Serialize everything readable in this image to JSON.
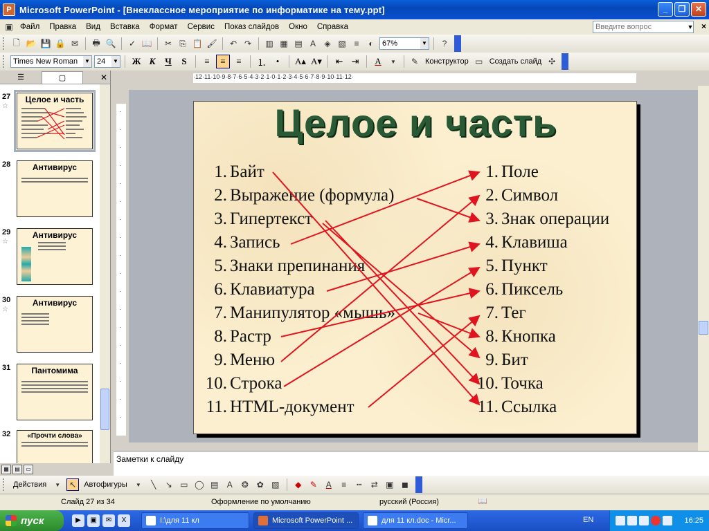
{
  "window": {
    "title": "Microsoft PowerPoint - [Внеклассное мероприятие по информатике на тему.ppt]",
    "app_icon_letter": "P"
  },
  "menu": {
    "items": [
      "Файл",
      "Правка",
      "Вид",
      "Вставка",
      "Формат",
      "Сервис",
      "Показ слайдов",
      "Окно",
      "Справка"
    ],
    "ask_placeholder": "Введите вопрос"
  },
  "toolbar": {
    "zoom": "67%"
  },
  "format_toolbar": {
    "font": "Times New Roman",
    "size": "24",
    "bold": "Ж",
    "italic": "К",
    "underline": "Ч",
    "shadow": "S",
    "designer": "Конструктор",
    "new_slide": "Создать слайд"
  },
  "slides_panel": {
    "thumbs": [
      {
        "num": "27",
        "title": "Целое и часть"
      },
      {
        "num": "28",
        "title": "Антивирус"
      },
      {
        "num": "29",
        "title": "Антивирус"
      },
      {
        "num": "30",
        "title": "Антивирус"
      },
      {
        "num": "31",
        "title": "Пантомима"
      },
      {
        "num": "32",
        "title": "«Прочти слова»"
      }
    ]
  },
  "ruler": {
    "horizontal": "·12·11·10·9·8·7·6·5·4·3·2·1·0·1·2·3·4·5·6·7·8·9·10·11·12·"
  },
  "slide": {
    "title": "Целое и часть",
    "left": [
      {
        "n": "1.",
        "t": "Байт"
      },
      {
        "n": "2.",
        "t": "Выражение (формула)"
      },
      {
        "n": "3.",
        "t": "Гипертекст"
      },
      {
        "n": "4.",
        "t": "Запись"
      },
      {
        "n": "5.",
        "t": "Знаки препинания"
      },
      {
        "n": "6.",
        "t": "Клавиатура"
      },
      {
        "n": "7.",
        "t": "Манипулятор «мышь»"
      },
      {
        "n": "8.",
        "t": "Растр"
      },
      {
        "n": "9.",
        "t": "Меню"
      },
      {
        "n": "10.",
        "t": "Строка"
      },
      {
        "n": "11.",
        "t": "HTML-документ"
      }
    ],
    "right": [
      {
        "n": "1.",
        "t": "Поле"
      },
      {
        "n": "2.",
        "t": "Символ"
      },
      {
        "n": "3.",
        "t": "Знак операции"
      },
      {
        "n": "4.",
        "t": "Клавиша"
      },
      {
        "n": "5.",
        "t": "Пункт"
      },
      {
        "n": "6.",
        "t": "Пиксель"
      },
      {
        "n": "7.",
        "t": "Тег"
      },
      {
        "n": "8.",
        "t": "Кнопка"
      },
      {
        "n": "9.",
        "t": "Бит"
      },
      {
        "n": "10.",
        "t": "Точка"
      },
      {
        "n": "11.",
        "t": "Ссылка"
      }
    ],
    "arrow_color": "#e0141e",
    "title_color": "#2a5a35"
  },
  "notes": {
    "placeholder": "Заметки к слайду"
  },
  "drawing": {
    "actions": "Действия",
    "autoshapes": "Автофигуры"
  },
  "status": {
    "slide": "Слайд 27 из 34",
    "design": "Оформление по умолчанию",
    "language": "русский (Россия)"
  },
  "taskbar": {
    "start": "пуск",
    "tasks": [
      "I:\\для 11 кл",
      "Microsoft PowerPoint ...",
      "для 11 кл.doc - Micr..."
    ],
    "lang": "EN",
    "clock": "16:25"
  }
}
